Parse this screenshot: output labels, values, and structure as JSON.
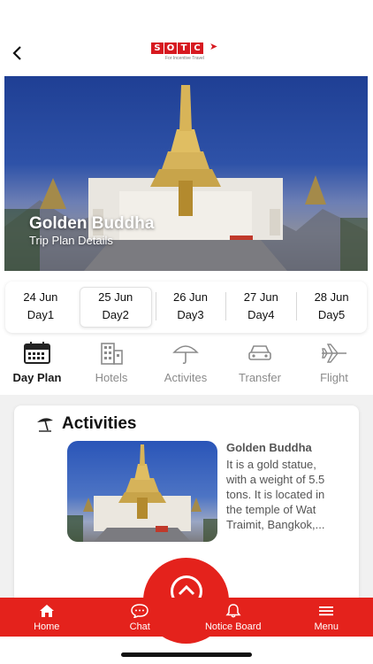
{
  "header": {
    "back_icon": "chevron-left-icon",
    "logo_letters": [
      "S",
      "O",
      "T",
      "C"
    ],
    "logo_tagline": "For Incentive Travel",
    "brand_color": "#d71920"
  },
  "hero": {
    "title": "Golden Buddha",
    "subtitle": "Trip Plan Details"
  },
  "days": [
    {
      "date": "24 Jun",
      "label": "Day1",
      "selected": false
    },
    {
      "date": "25 Jun",
      "label": "Day2",
      "selected": true
    },
    {
      "date": "26 Jun",
      "label": "Day3",
      "selected": false
    },
    {
      "date": "27 Jun",
      "label": "Day4",
      "selected": false
    },
    {
      "date": "28 Jun",
      "label": "Day5",
      "selected": false
    }
  ],
  "tabs": [
    {
      "label": "Day Plan",
      "icon": "calendar-icon",
      "active": true
    },
    {
      "label": "Hotels",
      "icon": "building-icon",
      "active": false
    },
    {
      "label": "Activites",
      "icon": "umbrella-icon",
      "active": false
    },
    {
      "label": "Transfer",
      "icon": "car-icon",
      "active": false
    },
    {
      "label": "Flight",
      "icon": "airplane-icon",
      "active": false
    }
  ],
  "activities": {
    "section_title": "Activities",
    "item": {
      "name": "Golden Buddha",
      "description": "It is a gold statue, with a weight of 5.5 tons. It is located in the temple of Wat Traimit, Bangkok,..."
    }
  },
  "bottom_nav": [
    {
      "label": "Home",
      "icon": "home-icon"
    },
    {
      "label": "Chat",
      "icon": "chat-icon"
    },
    {
      "label": "Notice Board",
      "icon": "bell-icon"
    },
    {
      "label": "Menu",
      "icon": "menu-icon"
    }
  ],
  "colors": {
    "accent": "#e4221c",
    "active_text": "#1a1a1a",
    "inactive_text": "#8b8b8b"
  }
}
